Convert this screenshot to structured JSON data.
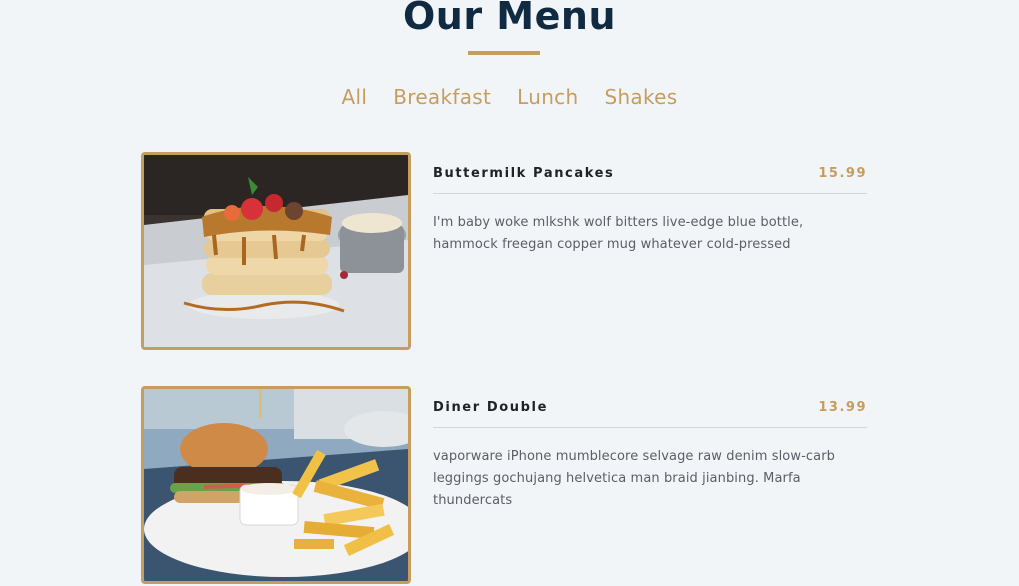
{
  "header": {
    "title": "Our Menu"
  },
  "filters": [
    "All",
    "Breakfast",
    "Lunch",
    "Shakes"
  ],
  "menu": [
    {
      "name": "Buttermilk Pancakes",
      "price": "15.99",
      "description": "I'm baby woke mlkshk wolf bitters live-edge blue bottle, hammock freegan copper mug whatever cold-pressed"
    },
    {
      "name": "Diner Double",
      "price": "13.99",
      "description": "vaporware iPhone mumblecore selvage raw denim slow-carb leggings gochujang helvetica man braid jianbing. Marfa thundercats"
    }
  ],
  "colors": {
    "background": "#f1f5f8",
    "title": "#102a42",
    "accent": "#c59d5f",
    "text": "#5a5f66"
  }
}
